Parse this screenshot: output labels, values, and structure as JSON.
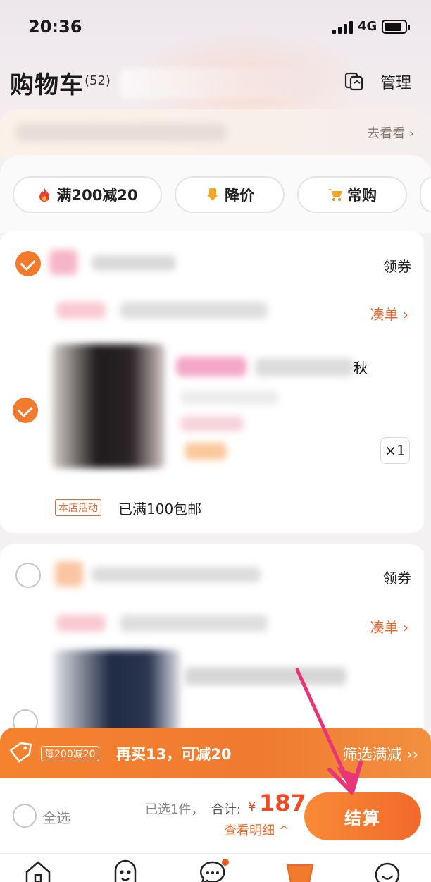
{
  "status_bar": {
    "time": "20:36",
    "network": "4G"
  },
  "header": {
    "title": "购物车",
    "count": "(52)",
    "manage_label": "管理"
  },
  "banner": {
    "link_label": "去看看 ›"
  },
  "filters": [
    {
      "label": "满200减20",
      "icon": "fire-icon"
    },
    {
      "label": "降价",
      "icon": "price-down-icon"
    },
    {
      "label": "常购",
      "icon": "cart-icon"
    }
  ],
  "cards": [
    {
      "coupon_label": "领券",
      "addon_label": "凑单 ›",
      "title_tail": "秋",
      "quantity": "×1",
      "store_tag": "本店活动",
      "shipping_text": "已满100包邮",
      "selected": true
    },
    {
      "coupon_label": "领券",
      "addon_label": "凑单 ›",
      "selected": false
    }
  ],
  "promo": {
    "badge": "每200减20",
    "text": "再买13，可减20",
    "link": "筛选满减 ››"
  },
  "checkout": {
    "select_all_label": "全选",
    "selected_info": "已选1件，",
    "total_label": "合计:",
    "currency": "¥",
    "total": "187",
    "detail_link": "查看明细 ^",
    "button_label": "结算"
  },
  "tabs": [
    "home-icon",
    "discover-icon",
    "message-icon",
    "cart-icon",
    "profile-icon"
  ],
  "colors": {
    "accent": "#f27a2c",
    "price": "#f04a22",
    "annotation": "#e8357a"
  }
}
